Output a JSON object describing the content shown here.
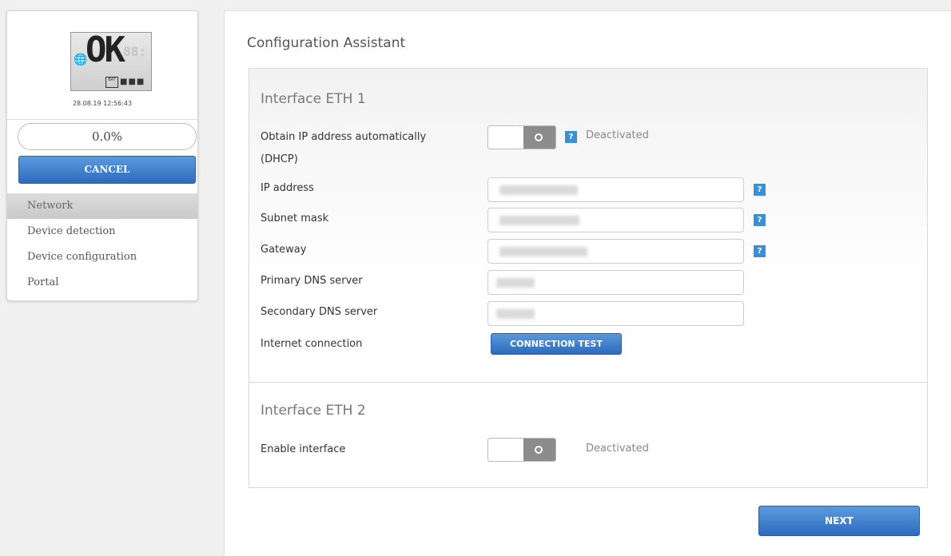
{
  "sidebar": {
    "lcd_text": "OK",
    "lcd_ghost": "88:",
    "battery_label": "BAT",
    "status_dots": "■■■",
    "timestamp": "28.08.19 12:56:43",
    "progress": "0.0%",
    "progress_value": 0.0,
    "cancel_label": "CANCEL",
    "nav": [
      {
        "label": "Network",
        "active": true
      },
      {
        "label": "Device detection",
        "active": false
      },
      {
        "label": "Device configuration",
        "active": false
      },
      {
        "label": "Portal",
        "active": false
      }
    ],
    "icons": {
      "globe": "globe-icon"
    }
  },
  "main": {
    "title": "Configuration Assistant",
    "eth1": {
      "title": "Interface ETH 1",
      "dhcp_label_line1": "Obtain IP address automatically",
      "dhcp_label_line2": "(DHCP)",
      "dhcp_status": "Deactivated",
      "ip_label": "IP address",
      "subnet_label": "Subnet mask",
      "gateway_label": "Gateway",
      "dns1_label": "Primary DNS server",
      "dns2_label": "Secondary DNS server",
      "internet_label": "Internet connection",
      "conn_test_label": "CONNECTION TEST",
      "help_glyph": "?"
    },
    "eth2": {
      "title": "Interface ETH 2",
      "enable_label": "Enable interface",
      "enable_status": "Deactivated"
    },
    "next_label": "NEXT"
  },
  "colors": {
    "accent": "#2e6bbd",
    "help": "#3a8fd6",
    "toggle_off": "#8c8c8c"
  }
}
